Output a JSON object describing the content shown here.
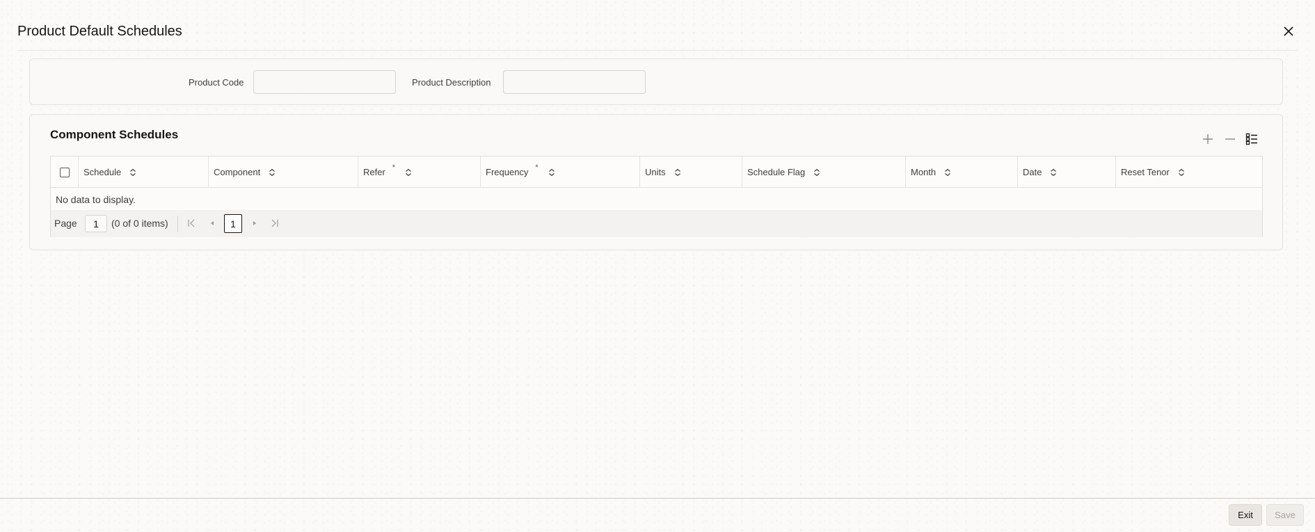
{
  "window": {
    "title": "Product Default Schedules",
    "close_icon": "close-icon"
  },
  "header": {
    "product_code_label": "Product Code",
    "product_code_value": "",
    "product_description_label": "Product Description",
    "product_description_value": ""
  },
  "component_schedules": {
    "title": "Component Schedules",
    "toolbar": {
      "add_icon": "plus-icon",
      "remove_icon": "minus-icon",
      "detail_icon": "single-record-view-icon"
    },
    "columns": [
      {
        "label": "Schedule",
        "required": false
      },
      {
        "label": "Component",
        "required": false
      },
      {
        "label": "Refer",
        "required": true
      },
      {
        "label": "Frequency",
        "required": true
      },
      {
        "label": "Units",
        "required": false
      },
      {
        "label": "Schedule Flag",
        "required": false
      },
      {
        "label": "Month",
        "required": false
      },
      {
        "label": "Date",
        "required": false
      },
      {
        "label": "Reset Tenor",
        "required": false
      }
    ],
    "required_marker": "*",
    "empty_message": "No data to display.",
    "pager": {
      "page_label": "Page",
      "page_value": "1",
      "count_text": "(0 of 0 items)",
      "current_page": "1"
    }
  },
  "footer": {
    "exit_label": "Exit",
    "save_label": "Save"
  },
  "colors": {
    "text": "#161513",
    "border": "#e1ded9",
    "disabled_text": "#a9a6a2"
  }
}
